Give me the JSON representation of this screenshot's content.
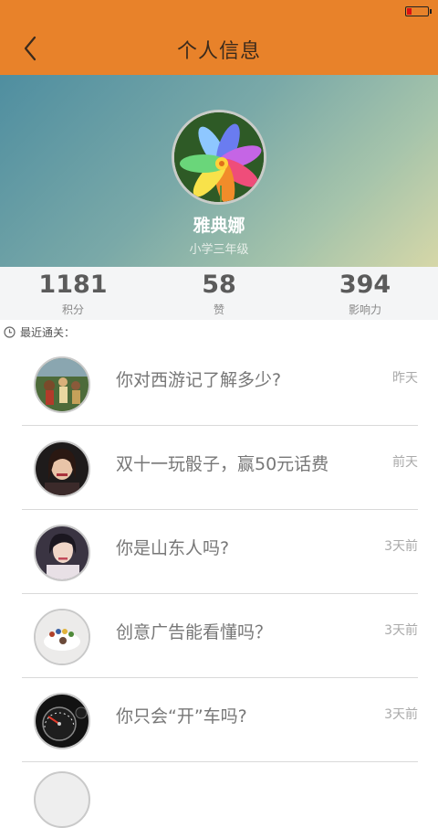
{
  "nav": {
    "title": "个人信息",
    "back_icon": "chevron-left-icon"
  },
  "status": {
    "battery_icon": "battery-low-icon",
    "battery_level": 0.2
  },
  "profile": {
    "name": "雅典娜",
    "grade": "小学三年级",
    "avatar_icon": "flower-avatar"
  },
  "stats": [
    {
      "value": "1181",
      "label": "积分"
    },
    {
      "value": "58",
      "label": "赞"
    },
    {
      "value": "394",
      "label": "影响力"
    }
  ],
  "recent": {
    "label": "最近通关："
  },
  "quizzes": [
    {
      "title": "你对西游记了解多少?",
      "time": "昨天",
      "thumb": "journey-west-thumb"
    },
    {
      "title": "双十一玩骰子，赢50元话费",
      "time": "前天",
      "thumb": "woman-portrait-thumb"
    },
    {
      "title": "你是山东人吗?",
      "time": "3天前",
      "thumb": "woman-portrait-thumb"
    },
    {
      "title": "创意广告能看懂吗？",
      "time": "3天前",
      "thumb": "creative-ad-thumb"
    },
    {
      "title": "你只会“开”车吗?",
      "time": "3天前",
      "thumb": "speedometer-thumb"
    }
  ],
  "colors": {
    "accent": "#e8822a",
    "text_muted": "#777777"
  }
}
